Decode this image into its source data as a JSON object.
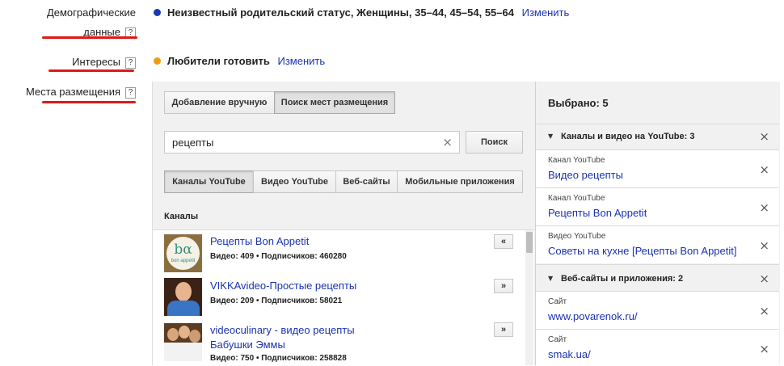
{
  "rows": {
    "demographics_label_1": "Демографические",
    "demographics_label_2": "данные",
    "demographics_value": "Неизвестный родительский статус, Женщины, 35–44, 45–54, 55–64",
    "interests_label": "Интересы",
    "interests_value": "Любители готовить",
    "placements_label": "Места размещения",
    "change_link": "Изменить",
    "help": "?"
  },
  "colors": {
    "demographics_dot": "#1a3ab0",
    "interests_dot": "#f39a14",
    "annotation": "#e01818",
    "link": "#1a33b0"
  },
  "left_panel": {
    "mode_tabs": [
      "Добавление вручную",
      "Поиск мест размещения"
    ],
    "search_value": "рецепты",
    "search_button": "Поиск",
    "type_tabs": [
      "Каналы YouTube",
      "Видео YouTube",
      "Веб-сайты",
      "Мобильные приложения"
    ],
    "list_header": "Каналы",
    "channels": [
      {
        "title": "Рецепты Bon Appetit",
        "stats": "Видео: 409 • Подписчиков: 460280",
        "action": "«",
        "thumb": "bon-appetit-logo"
      },
      {
        "title": "VIKKAvideo-Простые рецепты",
        "stats": "Видео: 209 • Подписчиков: 58021",
        "action": "»",
        "thumb": "woman-photo"
      },
      {
        "title": "videoculinary - видео рецепты",
        "title2": "Бабушки Эммы",
        "stats": "Видео: 750 • Подписчиков: 258828",
        "action": "»",
        "thumb": "group-photo"
      }
    ],
    "thumb_logo_text": "bon appetit"
  },
  "right_panel": {
    "title": "Выбрано: 5",
    "groups": [
      {
        "header": "Каналы и видео на YouTube: 3"
      },
      {
        "header": "Веб-сайты и приложения: 2"
      }
    ],
    "items": [
      {
        "type": "Канал YouTube",
        "name": "Видео рецепты"
      },
      {
        "type": "Канал YouTube",
        "name": "Рецепты Bon Appetit"
      },
      {
        "type": "Видео YouTube",
        "name": "Советы на кухне [Рецепты Bon Appetit]"
      },
      {
        "type": "Сайт",
        "name": "www.povarenok.ru/"
      },
      {
        "type": "Сайт",
        "name": "smak.ua/"
      }
    ],
    "remove_glyph": "×",
    "collapse_glyph": "▼"
  }
}
